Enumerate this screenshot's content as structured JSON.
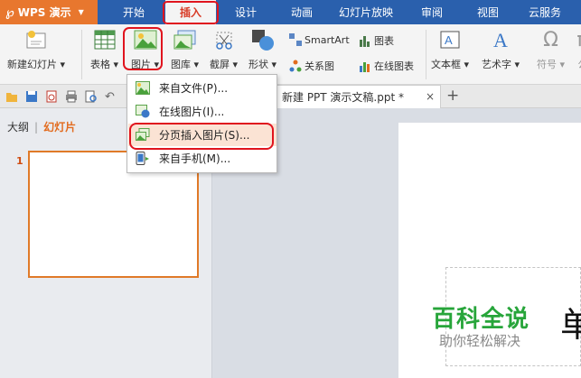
{
  "app": {
    "name": "WPS 演示"
  },
  "menu_tabs": [
    {
      "label": "开始"
    },
    {
      "label": "插入"
    },
    {
      "label": "设计"
    },
    {
      "label": "动画"
    },
    {
      "label": "幻灯片放映"
    },
    {
      "label": "审阅"
    },
    {
      "label": "视图"
    },
    {
      "label": "云服务"
    }
  ],
  "active_tab": "插入",
  "ribbon": {
    "new_slide": "新建幻灯片",
    "table": "表格",
    "picture": "图片",
    "gallery": "图库",
    "screenshot": "截屏",
    "shapes": "形状",
    "smartart": "SmartArt",
    "chart": "图表",
    "relation": "关系图",
    "online_chart": "在线图表",
    "textbox": "文本框",
    "wordart": "艺术字",
    "symbol": "符号",
    "formula": "公"
  },
  "doc_tab": {
    "title": "新建 PPT 演示文稿.ppt *",
    "close": "×"
  },
  "new_tab_symbol": "+",
  "left_panel": {
    "outline_tab": "大纲",
    "slides_tab": "幻灯片",
    "slide_number": "1"
  },
  "picture_menu": {
    "items": [
      {
        "label": "来自文件(P)..."
      },
      {
        "label": "在线图片(I)..."
      },
      {
        "label": "分页插入图片(S)..."
      },
      {
        "label": "来自手机(M)..."
      }
    ]
  },
  "slide": {
    "title_char": "单"
  },
  "watermark": {
    "title": "百科全说",
    "subtitle": "助你轻松解决"
  },
  "colors": {
    "menubar": "#2a60ad",
    "app_button": "#e8772e",
    "highlight_box": "#e0141e",
    "accent": "#e26b1e"
  }
}
